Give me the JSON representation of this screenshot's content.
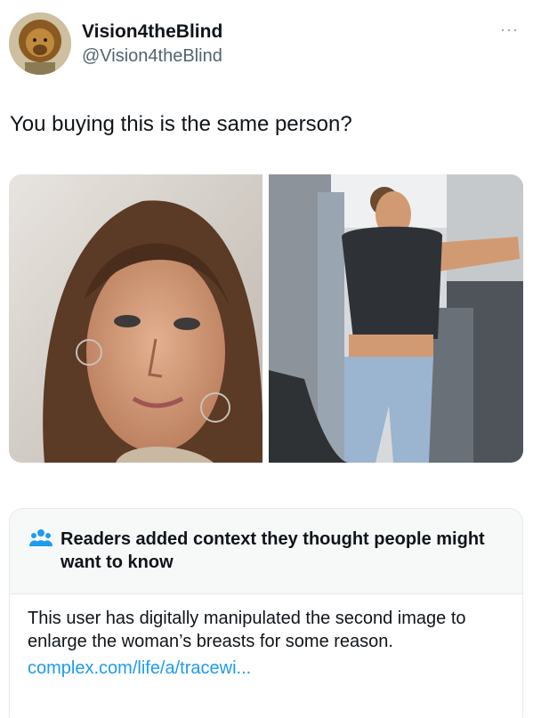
{
  "author": {
    "display_name": "Vision4theBlind",
    "handle": "@Vision4theBlind",
    "avatar_icon": "lion-avatar-icon"
  },
  "more_label": "···",
  "tweet": {
    "text": "You buying this is the same person?"
  },
  "media": {
    "count": 2
  },
  "community_note": {
    "icon": "people-icon",
    "title": "Readers added context they thought people might want to know",
    "body": "This user has digitally manipulated the second image to enlarge the woman’s breasts for some reason.",
    "link": "complex.com/life/a/tracewi..."
  },
  "colors": {
    "link": "#1d9bf0",
    "secondary_text": "#536471",
    "note_header_bg": "#f7f9f9"
  }
}
